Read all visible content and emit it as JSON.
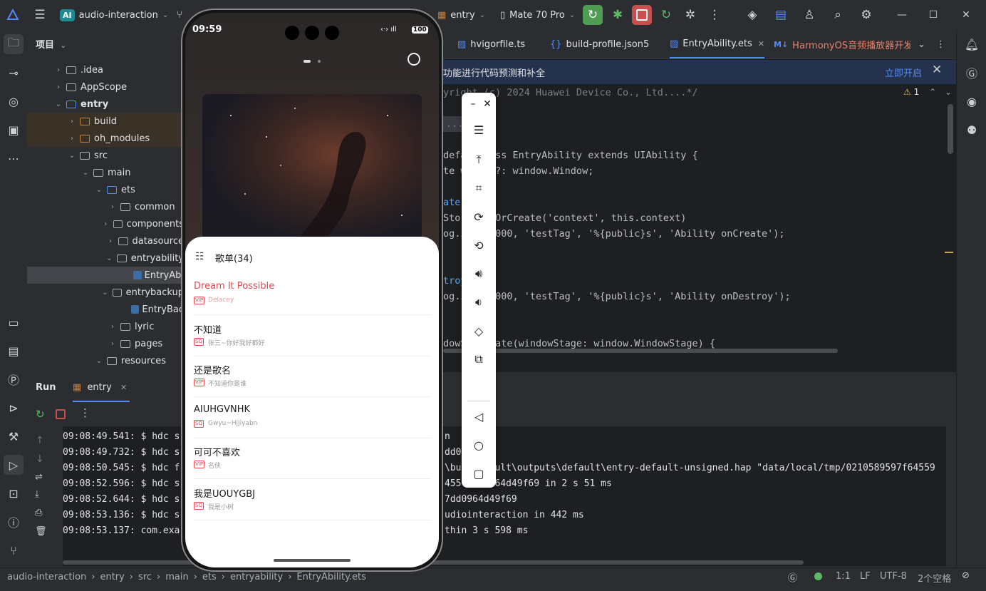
{
  "titlebar": {
    "project_badge": "AI",
    "project_name": "audio-interaction",
    "module": "entry",
    "device": "Mate 70 Pro"
  },
  "project_panel": {
    "title": "项目",
    "tree": [
      {
        "label": ".idea",
        "indent": 1,
        "type": "folder"
      },
      {
        "label": "AppScope",
        "indent": 1,
        "type": "folder"
      },
      {
        "label": "entry",
        "indent": 1,
        "type": "module",
        "expanded": true
      },
      {
        "label": "build",
        "indent": 2,
        "type": "folder-orange"
      },
      {
        "label": "oh_modules",
        "indent": 2,
        "type": "folder-orange"
      },
      {
        "label": "src",
        "indent": 2,
        "type": "folder",
        "expanded": true
      },
      {
        "label": "main",
        "indent": 3,
        "type": "folder",
        "expanded": true
      },
      {
        "label": "ets",
        "indent": 4,
        "type": "folder-blue",
        "expanded": true
      },
      {
        "label": "common",
        "indent": 5,
        "type": "folder"
      },
      {
        "label": "components",
        "indent": 5,
        "type": "folder"
      },
      {
        "label": "datasource",
        "indent": 5,
        "type": "folder"
      },
      {
        "label": "entryability",
        "indent": 5,
        "type": "folder",
        "expanded": true
      },
      {
        "label": "EntryAbi",
        "indent": 6,
        "type": "file",
        "selected": true
      },
      {
        "label": "entrybackup",
        "indent": 5,
        "type": "folder",
        "expanded": true
      },
      {
        "label": "EntryBac",
        "indent": 6,
        "type": "file"
      },
      {
        "label": "lyric",
        "indent": 5,
        "type": "folder"
      },
      {
        "label": "pages",
        "indent": 5,
        "type": "folder"
      },
      {
        "label": "resources",
        "indent": 4,
        "type": "folder",
        "expanded": true
      }
    ]
  },
  "editor": {
    "tabs": [
      {
        "label": "hvigorfile.ts"
      },
      {
        "label": "build-profile.json5"
      },
      {
        "label": "EntryAbility.ets",
        "active": true
      },
      {
        "label": "HarmonyOS音频播放器开发教"
      }
    ],
    "banner_text": "功能进行代码预测和补全",
    "banner_action": "立即开启",
    "warning_count": "1",
    "code_lines": [
      {
        "text": "yright (c) 2024 Huawei Device Co., Ltd....*/",
        "style": "comment"
      },
      {
        "text": "...",
        "style": "fold"
      },
      {
        "text": "defa   lass EntryAbility extends UIAbility {",
        "style": "class"
      },
      {
        "text": "te w   bj?: window.Window;",
        "style": "plain"
      },
      {
        "text": "ate(",
        "style": "fn"
      },
      {
        "text": "Stor   etOrCreate('context', this.context)",
        "style": "plain"
      },
      {
        "text": "og.i   x0000, 'testTag', '%{public}s', 'Ability onCreate');",
        "style": "plain"
      },
      {
        "text": "troy",
        "style": "fn"
      },
      {
        "text": "og.i   x0000, 'testTag', '%{public}s', 'Ability onDestroy');",
        "style": "plain"
      },
      {
        "text": "dowS   reate(windowStage: window.WindowStage) {",
        "style": "plain"
      }
    ]
  },
  "run_panel": {
    "title": "Run",
    "config": "entry",
    "log_lines": [
      "09:08:49.541: $ hdc s",
      "09:08:49.732: $ hdc s",
      "09:08:50.545: $ hdc f",
      "09:08:52.596: $ hdc s",
      "09:08:52.644: $ hdc s",
      "09:08:53.136: $ hdc s",
      "09:08:53.137: com.exa"
    ],
    "log_tails": [
      "n",
      "dd0   f69",
      "\\bu   efault\\outputs\\default\\entry-default-unsigned.hap \"data/local/tmp/0210589597f64559",
      "455   d0964d49f69 in 2 s 51 ms",
      "7dd0964d49f69",
      "udiointeraction in 442 ms",
      "thin 3 s 598 ms"
    ]
  },
  "statusbar": {
    "breadcrumb": [
      "audio-interaction",
      "entry",
      "src",
      "main",
      "ets",
      "entryability",
      "EntryAbility.ets"
    ],
    "position": "1:1",
    "line_sep": "LF",
    "encoding": "UTF-8",
    "indent": "2个空格"
  },
  "phone": {
    "time": "09:59",
    "battery": "100",
    "playlist_title": "歌单(34)",
    "songs": [
      {
        "title": "Dream It Possible",
        "badge": "VIP",
        "artist": "Delacey",
        "active": true
      },
      {
        "title": "不知道",
        "badge": "SQ",
        "artist": "张三~你好我好都好"
      },
      {
        "title": "还是歌名",
        "badge": "VIP",
        "artist": "不知道你是谁"
      },
      {
        "title": "AIUHGVNHK",
        "badge": "SQ",
        "artist": "Gwyu~Hjjiyabn"
      },
      {
        "title": "可可不喜欢",
        "badge": "VIP",
        "artist": "名侠"
      },
      {
        "title": "我是UOUYGBJ",
        "badge": "SQ",
        "artist": "我是小树"
      }
    ]
  },
  "colors": {
    "accent_red": "#e5484d",
    "ide_bg": "#1e1f22",
    "panel_bg": "#2b2d30",
    "run_green": "#5fb865"
  }
}
